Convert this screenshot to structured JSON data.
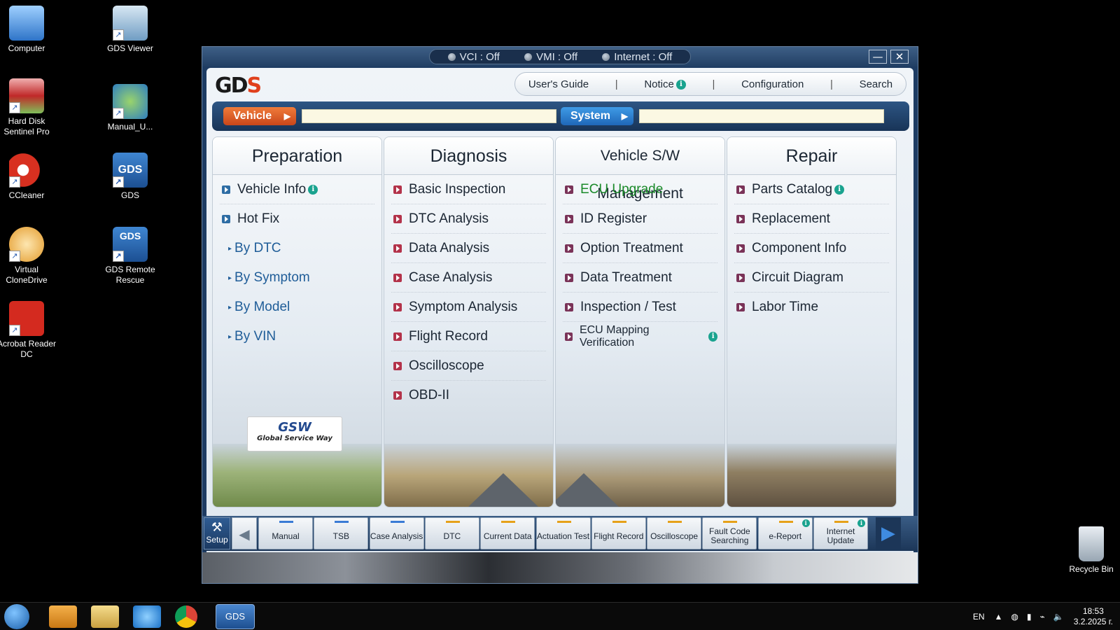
{
  "desktop": {
    "icons": [
      {
        "label": "Computer"
      },
      {
        "label": "GDS Viewer"
      },
      {
        "label": "Hard Disk Sentinel Pro"
      },
      {
        "label": "Manual_U..."
      },
      {
        "label": "CCleaner"
      },
      {
        "label": "GDS"
      },
      {
        "label": "Virtual CloneDrive"
      },
      {
        "label": "GDS Remote Rescue"
      },
      {
        "label": "Acrobat Reader DC"
      },
      {
        "label": "Recycle Bin"
      }
    ],
    "icon_texts": {
      "gds": "GDS",
      "gds_remote": "GDS"
    }
  },
  "window": {
    "status": {
      "vci": "VCI : Off",
      "vmi": "VMI : Off",
      "internet": "Internet : Off"
    },
    "controls": {
      "minimize": "—",
      "close": "✕"
    }
  },
  "header": {
    "logo_main": "GD",
    "logo_accent": "S",
    "menu": {
      "users_guide": "User's Guide",
      "notice": "Notice",
      "configuration": "Configuration",
      "search": "Search",
      "separator": "|",
      "info_glyph": "i"
    }
  },
  "selectors": {
    "vehicle": {
      "label": "Vehicle",
      "value": ""
    },
    "system": {
      "label": "System",
      "value": ""
    },
    "arrow": "▶"
  },
  "panels": {
    "preparation": {
      "title": "Preparation",
      "items": [
        "Vehicle Info",
        "Hot Fix"
      ],
      "subitems": [
        "By DTC",
        "By Symptom",
        "By Model",
        "By VIN"
      ],
      "caret": "▸"
    },
    "diagnosis": {
      "title": "Diagnosis",
      "items": [
        "Basic Inspection",
        "DTC Analysis",
        "Data Analysis",
        "Case Analysis",
        "Symptom Analysis",
        "Flight Record",
        "Oscilloscope",
        "OBD-II"
      ]
    },
    "sw_management": {
      "title": "Vehicle S/W Management",
      "items": [
        "ECU Upgrade",
        "ID Register",
        "Option Treatment",
        "Data Treatment",
        "Inspection / Test",
        "ECU Mapping Verification"
      ]
    },
    "repair": {
      "title": "Repair",
      "items": [
        "Parts Catalog",
        "Replacement",
        "Component Info",
        "Circuit Diagram",
        "Labor Time"
      ]
    }
  },
  "gsw": {
    "mark": "GSW",
    "text": "Global Service Way"
  },
  "toolbar": {
    "setup": "Setup",
    "setup_glyph": "⚒",
    "prev": "◀",
    "next": "▶",
    "buttons": [
      {
        "label": "Manual",
        "color": "#3a7bd5"
      },
      {
        "label": "TSB",
        "color": "#3a7bd5"
      },
      {
        "label": "Case Analysis",
        "color": "#3a7bd5"
      },
      {
        "label": "DTC",
        "color": "#e6a11a"
      },
      {
        "label": "Current Data",
        "color": "#e6a11a"
      },
      {
        "label": "Actuation Test",
        "color": "#e6a11a"
      },
      {
        "label": "Flight Record",
        "color": "#e6a11a"
      },
      {
        "label": "Oscilloscope",
        "color": "#e6a11a"
      },
      {
        "label": "Fault Code Searching",
        "color": "#e6a11a"
      },
      {
        "label": "e-Report",
        "color": "#e6a11a"
      },
      {
        "label": "Internet Update",
        "color": "#e6a11a"
      }
    ]
  },
  "taskbar": {
    "active_app": "GDS",
    "language": "EN",
    "time": "18:53",
    "date": "3.2.2025 г."
  }
}
